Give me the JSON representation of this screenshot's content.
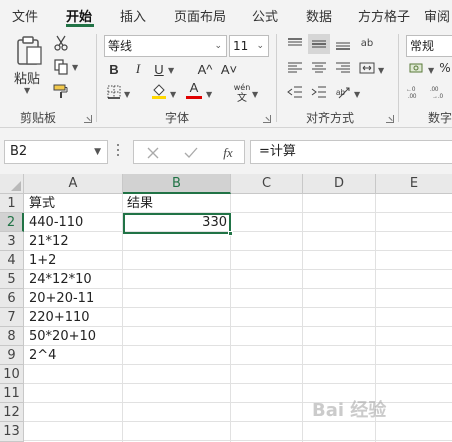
{
  "tabs": [
    "文件",
    "开始",
    "插入",
    "页面布局",
    "公式",
    "数据",
    "方方格子",
    "审阅"
  ],
  "ribbon": {
    "clipboard": {
      "paste_label": "粘贴",
      "group_label": "剪贴板"
    },
    "font": {
      "font_name": "等线",
      "font_size": "11",
      "bold": "B",
      "italic": "I",
      "underline": "U",
      "increase_size": "A^",
      "decrease_size": "A˅",
      "phonetic": "wén",
      "font_color_glyph": "A",
      "group_label": "字体"
    },
    "alignment": {
      "group_label": "对齐方式",
      "wrap_glyph": "ab"
    },
    "number": {
      "format": "常规",
      "group_label": "数字"
    }
  },
  "colors": {
    "accent": "#217346",
    "fill_yellow": "#ffd700",
    "font_red": "#e00000"
  },
  "formula_bar": {
    "name_box": "B2",
    "fx_label": "fx",
    "content": "=计算"
  },
  "sheet": {
    "columns": [
      "A",
      "B",
      "C",
      "D",
      "E"
    ],
    "rows": [
      "1",
      "2",
      "3",
      "4",
      "5",
      "6",
      "7",
      "8",
      "9",
      "10",
      "11",
      "12",
      "13"
    ],
    "active_cell": "B2",
    "cells": {
      "A1": "算式",
      "B1": "结果",
      "A2": "440-110",
      "B2": "330",
      "A3": "21*12",
      "A4": "1+2",
      "A5": "24*12*10",
      "A6": "20+20-11",
      "A7": "220+110",
      "A8": "50*20+10",
      "A9": "2^4"
    }
  },
  "watermark": "Bai 经验"
}
